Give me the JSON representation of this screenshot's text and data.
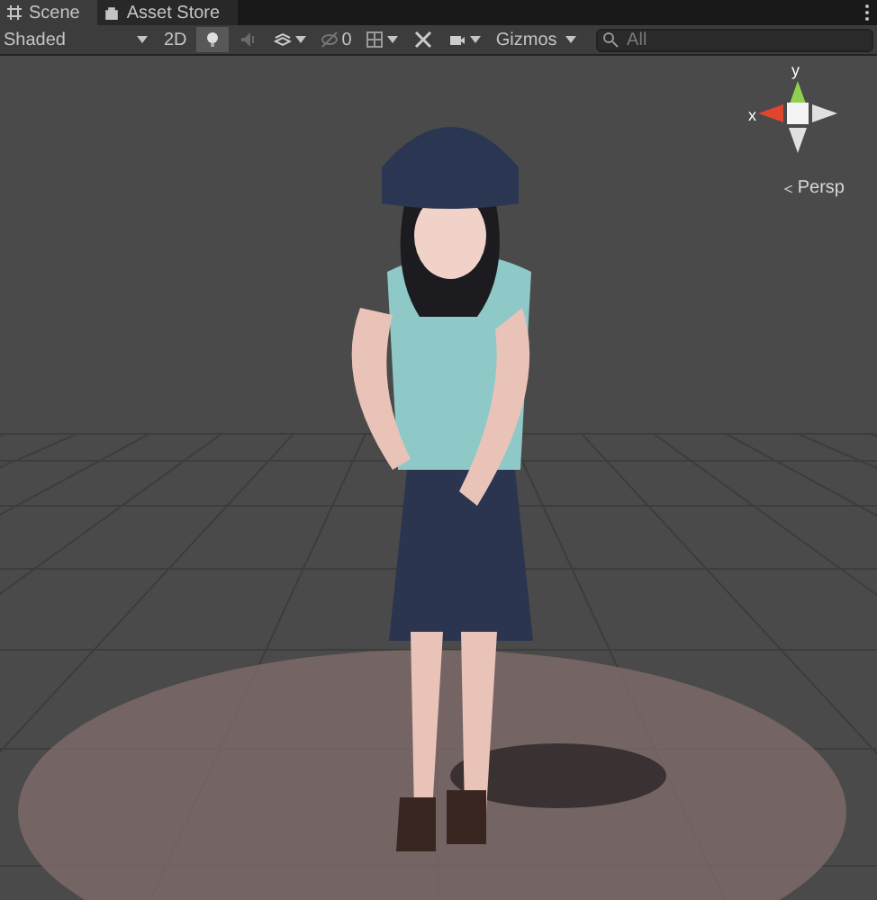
{
  "tabs": [
    {
      "label": "Scene",
      "selected": true
    },
    {
      "label": "Asset Store",
      "selected": false
    }
  ],
  "toolbar": {
    "shading_mode": "Shaded",
    "mode_2d": {
      "label": "2D",
      "selected": false
    },
    "lighting": {
      "on": true
    },
    "audio": {
      "on": false
    },
    "hidden_count": "0",
    "gizmos": "Gizmos",
    "search": {
      "placeholder": "All"
    }
  },
  "orientation_gizmo": {
    "y_label": "y",
    "x_label": "x",
    "projection": "Persp"
  }
}
